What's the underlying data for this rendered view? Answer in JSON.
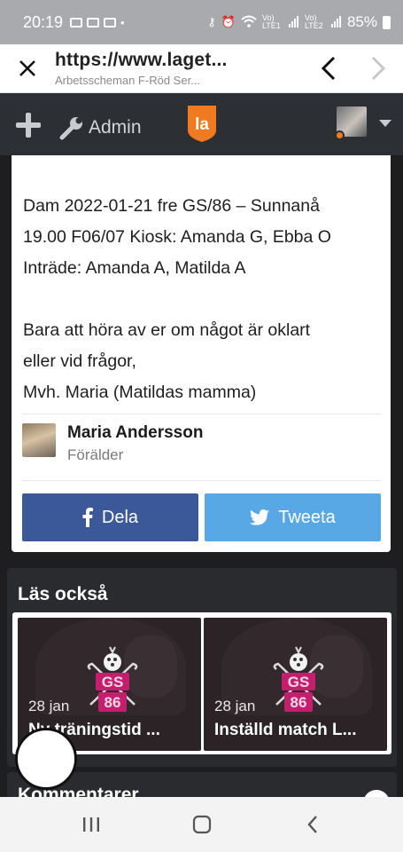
{
  "status_bar": {
    "time": "20:19",
    "battery": "85%",
    "network_1": "Vo) LTE1",
    "network_2": "Vo) LTE2"
  },
  "browser": {
    "url": "https://www.laget...",
    "page_title": "Arbetsscheman F-Röd Ser..."
  },
  "app_header": {
    "admin_label": "Admin",
    "logo_text": "la"
  },
  "article": {
    "lines": [
      "Dam 2022-01-21 fre GS/86 – Sunnanå",
      "19.00 F06/07 Kiosk: Amanda G, Ebba O",
      "Inträde: Amanda A, Matilda A",
      "",
      "Bara att höra av er om något är oklart",
      "eller vid frågor,",
      "Mvh. Maria (Matildas mamma)"
    ],
    "author": {
      "name": "Maria Andersson",
      "role": "Förälder"
    },
    "share": {
      "facebook_label": "Dela",
      "twitter_label": "Tweeta",
      "facebook_color": "#3b5998",
      "twitter_color": "#59a8e6"
    }
  },
  "read_also": {
    "title": "Läs också",
    "items": [
      {
        "date": "28 jan",
        "title": "Ny träningstid ...",
        "logo_text": "GS 86"
      },
      {
        "date": "28 jan",
        "title": "Inställd match L...",
        "logo_text": "GS 86"
      }
    ]
  },
  "comments": {
    "title": "Kommentarer"
  },
  "colors": {
    "accent": "#f07a1f",
    "header_bg": "#2c2f33",
    "page_bg": "#1e1e20"
  }
}
